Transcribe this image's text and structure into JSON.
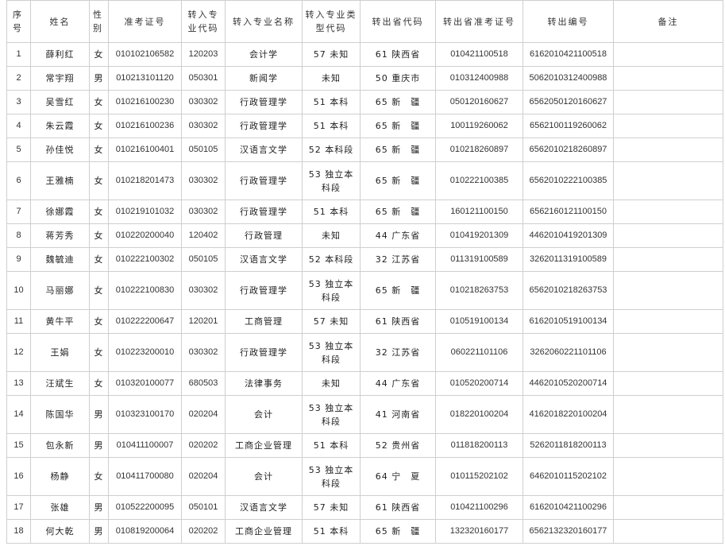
{
  "headers": [
    "序号",
    "姓名",
    "性别",
    "准考证号",
    "转入专业代码",
    "转入专业名称",
    "转入专业类型代码",
    "转出省代码",
    "转出省准考证号",
    "转出编号",
    "备注"
  ],
  "rows": [
    {
      "no": "1",
      "name": "薛利红",
      "gender": "女",
      "exam_id": "010102106582",
      "major_code": "120203",
      "major_name": "会计学",
      "type_code": "57 未知",
      "prov": "61 陕西省",
      "prov_exam_id": "010421100518",
      "out_no": "6162010421100518",
      "note": ""
    },
    {
      "no": "2",
      "name": "常宇翔",
      "gender": "男",
      "exam_id": "010213101120",
      "major_code": "050301",
      "major_name": "新闻学",
      "type_code": "未知",
      "prov": "50 重庆市",
      "prov_exam_id": "010312400988",
      "out_no": "5062010312400988",
      "note": ""
    },
    {
      "no": "3",
      "name": "吴雪红",
      "gender": "女",
      "exam_id": "010216100230",
      "major_code": "030302",
      "major_name": "行政管理学",
      "type_code": "51 本科",
      "prov": "65 新　疆",
      "prov_exam_id": "050120160627",
      "out_no": "6562050120160627",
      "note": ""
    },
    {
      "no": "4",
      "name": "朱云霞",
      "gender": "女",
      "exam_id": "010216100236",
      "major_code": "030302",
      "major_name": "行政管理学",
      "type_code": "51 本科",
      "prov": "65 新　疆",
      "prov_exam_id": "100119260062",
      "out_no": "6562100119260062",
      "note": ""
    },
    {
      "no": "5",
      "name": "孙佳悦",
      "gender": "女",
      "exam_id": "010216100401",
      "major_code": "050105",
      "major_name": "汉语言文学",
      "type_code": "52 本科段",
      "prov": "65 新　疆",
      "prov_exam_id": "010218260897",
      "out_no": "6562010218260897",
      "note": ""
    },
    {
      "no": "6",
      "name": "王雅楠",
      "gender": "女",
      "exam_id": "010218201473",
      "major_code": "030302",
      "major_name": "行政管理学",
      "type_code": "53 独立本科段",
      "prov": "65 新　疆",
      "prov_exam_id": "010222100385",
      "out_no": "6562010222100385",
      "note": ""
    },
    {
      "no": "7",
      "name": "徐娜霞",
      "gender": "女",
      "exam_id": "010219101032",
      "major_code": "030302",
      "major_name": "行政管理学",
      "type_code": "51 本科",
      "prov": "65 新　疆",
      "prov_exam_id": "160121100150",
      "out_no": "6562160121100150",
      "note": ""
    },
    {
      "no": "8",
      "name": "蒋芳秀",
      "gender": "女",
      "exam_id": "010220200040",
      "major_code": "120402",
      "major_name": "行政管理",
      "type_code": "未知",
      "prov": "44 广东省",
      "prov_exam_id": "010419201309",
      "out_no": "4462010419201309",
      "note": ""
    },
    {
      "no": "9",
      "name": "魏毓迪",
      "gender": "女",
      "exam_id": "010222100302",
      "major_code": "050105",
      "major_name": "汉语言文学",
      "type_code": "52 本科段",
      "prov": "32 江苏省",
      "prov_exam_id": "011319100589",
      "out_no": "3262011319100589",
      "note": ""
    },
    {
      "no": "10",
      "name": "马丽娜",
      "gender": "女",
      "exam_id": "010222100830",
      "major_code": "030302",
      "major_name": "行政管理学",
      "type_code": "53 独立本科段",
      "prov": "65 新　疆",
      "prov_exam_id": "010218263753",
      "out_no": "6562010218263753",
      "note": ""
    },
    {
      "no": "11",
      "name": "黄牛平",
      "gender": "女",
      "exam_id": "010222200647",
      "major_code": "120201",
      "major_name": "工商管理",
      "type_code": "57 未知",
      "prov": "61 陕西省",
      "prov_exam_id": "010519100134",
      "out_no": "6162010519100134",
      "note": ""
    },
    {
      "no": "12",
      "name": "王娟",
      "gender": "女",
      "exam_id": "010223200010",
      "major_code": "030302",
      "major_name": "行政管理学",
      "type_code": "53 独立本科段",
      "prov": "32 江苏省",
      "prov_exam_id": "060221101106",
      "out_no": "3262060221101106",
      "note": ""
    },
    {
      "no": "13",
      "name": "汪斌生",
      "gender": "女",
      "exam_id": "010320100077",
      "major_code": "680503",
      "major_name": "法律事务",
      "type_code": "未知",
      "prov": "44 广东省",
      "prov_exam_id": "010520200714",
      "out_no": "4462010520200714",
      "note": ""
    },
    {
      "no": "14",
      "name": "陈国华",
      "gender": "男",
      "exam_id": "010323100170",
      "major_code": "020204",
      "major_name": "会计",
      "type_code": "53 独立本科段",
      "prov": "41 河南省",
      "prov_exam_id": "018220100204",
      "out_no": "4162018220100204",
      "note": ""
    },
    {
      "no": "15",
      "name": "包永新",
      "gender": "男",
      "exam_id": "010411100007",
      "major_code": "020202",
      "major_name": "工商企业管理",
      "type_code": "51 本科",
      "prov": "52 贵州省",
      "prov_exam_id": "011818200113",
      "out_no": "5262011818200113",
      "note": ""
    },
    {
      "no": "16",
      "name": "杨静",
      "gender": "女",
      "exam_id": "010411700080",
      "major_code": "020204",
      "major_name": "会计",
      "type_code": "53 独立本科段",
      "prov": "64 宁　夏",
      "prov_exam_id": "010115202102",
      "out_no": "6462010115202102",
      "note": ""
    },
    {
      "no": "17",
      "name": "张雄",
      "gender": "男",
      "exam_id": "010522200095",
      "major_code": "050101",
      "major_name": "汉语言文学",
      "type_code": "57 未知",
      "prov": "61 陕西省",
      "prov_exam_id": "010421100296",
      "out_no": "6162010421100296",
      "note": ""
    },
    {
      "no": "18",
      "name": "何大乾",
      "gender": "男",
      "exam_id": "010819200064",
      "major_code": "020202",
      "major_name": "工商企业管理",
      "type_code": "51 本科",
      "prov": "65 新　疆",
      "prov_exam_id": "132320160177",
      "out_no": "6562132320160177",
      "note": ""
    }
  ],
  "tall_rows": [
    "6",
    "10",
    "12",
    "14",
    "16"
  ]
}
